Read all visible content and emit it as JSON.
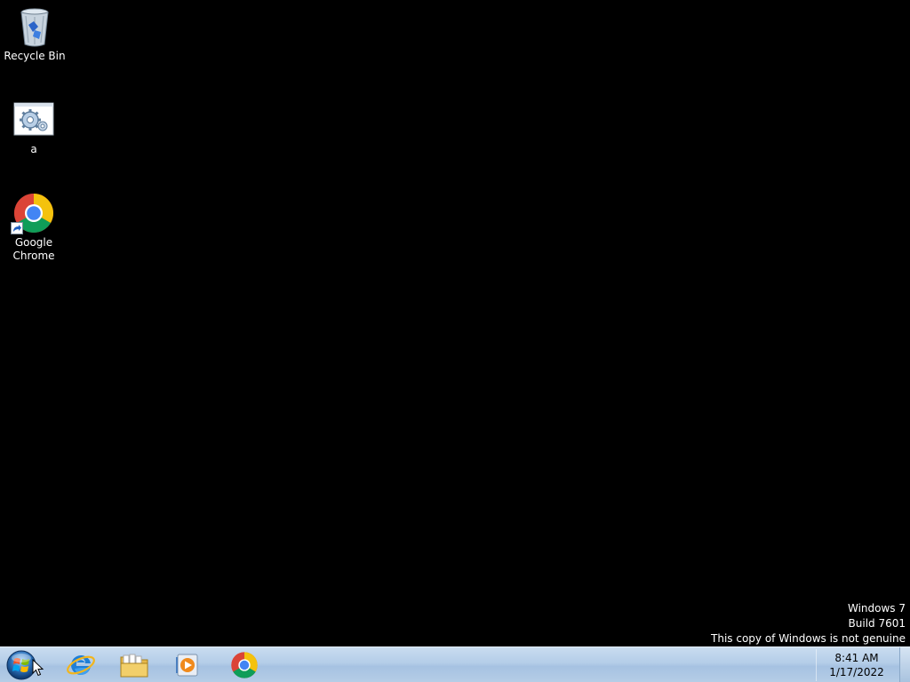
{
  "desktop": {
    "icons": [
      {
        "label": "Recycle Bin",
        "icon": "recycle-bin-icon"
      },
      {
        "label": "a",
        "icon": "settings-shortcut-icon"
      },
      {
        "label": "Google Chrome",
        "icon": "chrome-icon"
      }
    ]
  },
  "watermark": {
    "line1": "Windows 7",
    "line2": "Build 7601",
    "line3": "This copy of Windows is not genuine"
  },
  "taskbar": {
    "start_icon": "windows-start-orb-icon",
    "pinned": [
      {
        "name": "Internet Explorer",
        "icon": "internet-explorer-icon"
      },
      {
        "name": "Windows Explorer",
        "icon": "folder-explorer-icon"
      },
      {
        "name": "Windows Media Player",
        "icon": "media-player-icon"
      },
      {
        "name": "Google Chrome",
        "icon": "chrome-icon"
      }
    ],
    "clock": {
      "time": "8:41 AM",
      "date": "1/17/2022"
    }
  },
  "colors": {
    "desktop_bg": "#000000",
    "taskbar_bg": "#b4cde8",
    "chrome_red": "#db4437",
    "chrome_yellow": "#f4c20d",
    "chrome_green": "#0f9d58",
    "chrome_blue": "#4285f4"
  }
}
